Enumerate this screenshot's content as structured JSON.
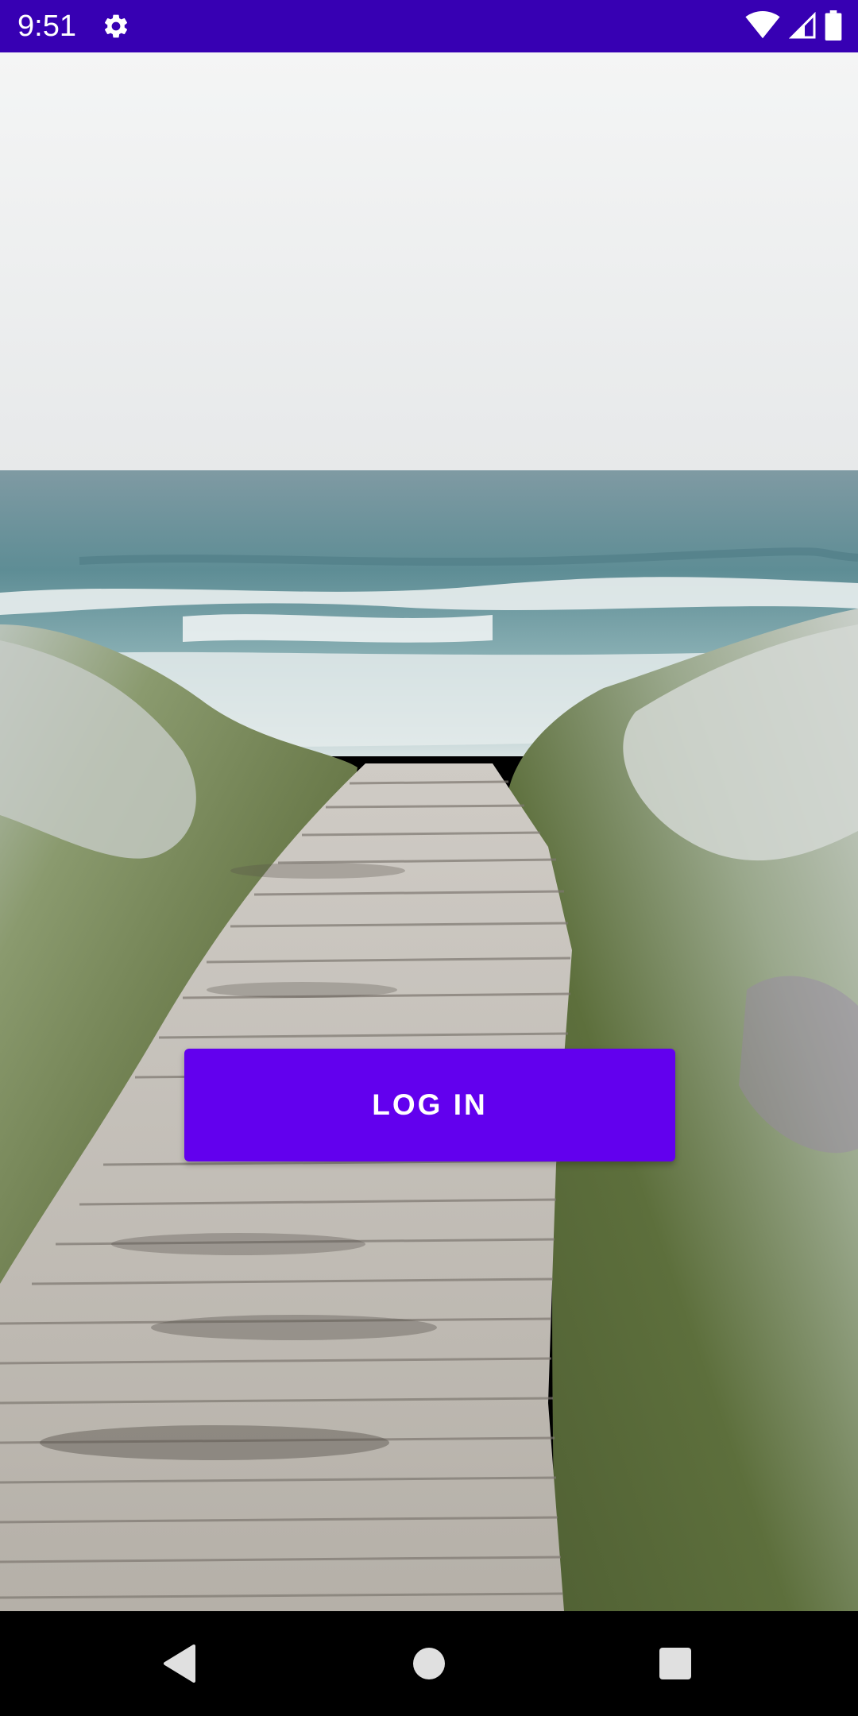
{
  "status_bar": {
    "time": "9:51",
    "settings_icon": "gear-icon",
    "wifi_icon": "wifi-icon",
    "signal_icon": "signal-icon",
    "battery_icon": "battery-icon",
    "background_color": "#3700b3"
  },
  "main": {
    "background_image": "beach-boardwalk-photo",
    "login_button": {
      "label": "LOG IN",
      "color": "#6200ee"
    }
  },
  "nav_bar": {
    "back_icon": "back-triangle-icon",
    "home_icon": "home-circle-icon",
    "recents_icon": "recents-square-icon"
  }
}
